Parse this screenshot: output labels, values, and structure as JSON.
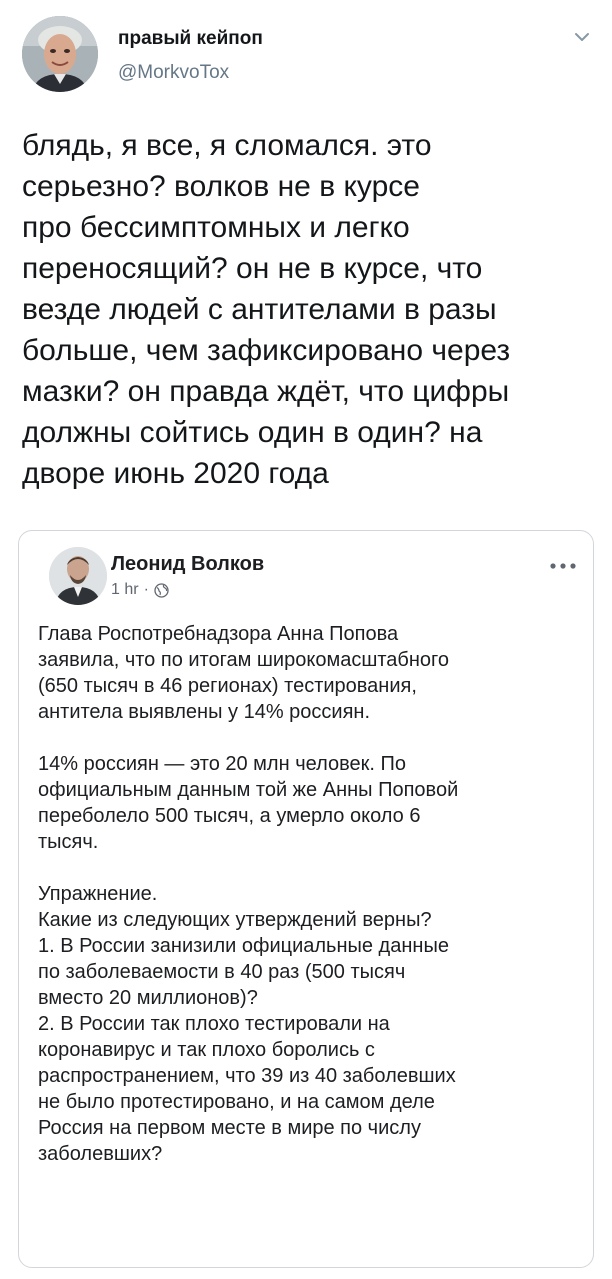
{
  "tweet": {
    "author_name": "правый кейпоп",
    "author_handle": "@MorkvoTox",
    "text_lines": [
      "блядь, я все, я сломался. это",
      "серьезно? волков не в курсе",
      "про бессимптомных и легко",
      "переносящий? он не в курсе, что",
      "везде людей с антителами в разы",
      "больше, чем зафиксировано через",
      "мазки? он правда ждёт, что цифры",
      "должны сойтись один в один? на",
      "дворе июнь 2020 года"
    ]
  },
  "quoted_post": {
    "author_name": "Леонид Волков",
    "time": "1 hr",
    "dot": "·",
    "paragraphs": [
      [
        "Глава Роспотребнадзора Анна Попова",
        "заявила, что по итогам широкомасштабного",
        "(650 тысяч в 46 регионах) тестирования,",
        "антитела выявлены у 14% россиян."
      ],
      [
        "14% россиян — это 20 млн человек. По",
        "официальным данным той же Анны Поповой",
        "переболело 500 тысяч, а умерло около 6",
        "тысяч."
      ],
      [
        "Упражнение.",
        "Какие из следующих утверждений верны?",
        "1. В России занизили официальные данные",
        "по заболеваемости в 40 раз (500 тысяч",
        "вместо 20 миллионов)?",
        "2. В России так плохо тестировали на",
        "коронавирус и так плохо боролись с",
        "распространением, что 39 из 40 заболевших",
        "не было протестировано, и на самом деле",
        "Россия на первом месте в мире по числу",
        "заболевших?"
      ]
    ]
  },
  "icons": {
    "caret": "chevron-down-icon",
    "globe": "globe-icon",
    "more": "more-options-icon"
  },
  "colors": {
    "text_primary": "#14171a",
    "text_secondary": "#657786",
    "card_border": "#d2d6da"
  }
}
